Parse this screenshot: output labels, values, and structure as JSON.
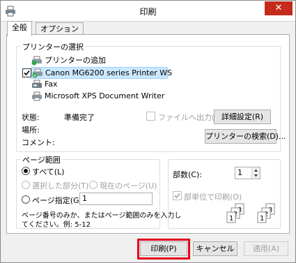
{
  "window": {
    "title": "印刷",
    "close": "✕"
  },
  "tabs": [
    "全般",
    "オプション"
  ],
  "printer_select": {
    "legend": "プリンターの選択",
    "items": [
      {
        "label": "プリンターの追加",
        "icon": "add-printer-icon",
        "checked": false,
        "selected": false
      },
      {
        "label": "Canon MG6200 series Printer WS",
        "icon": "printer-icon",
        "checked": true,
        "selected": true
      },
      {
        "label": "Fax",
        "icon": "fax-icon",
        "checked": false,
        "selected": false
      },
      {
        "label": "Microsoft XPS Document Writer",
        "icon": "printer-icon",
        "checked": false,
        "selected": false
      }
    ],
    "status_label": "状態:",
    "status_value": "準備完了",
    "location_label": "場所:",
    "comment_label": "コメント:",
    "print_to_file": "ファイルへ出力(F)",
    "preferences_button": "詳細設定(R)",
    "find_printer_button": "プリンターの検索(D)..."
  },
  "page_range": {
    "legend": "ページ範囲",
    "all": "すべて(L)",
    "selection": "選択した部分(T)",
    "current_page": "現在のページ(U)",
    "pages": "ページ指定(G):",
    "pages_value": "1",
    "hint_line1": "ページ番号のみか、またはページ範囲のみを入力し",
    "hint_line2": "てください。例: 5-12"
  },
  "copies": {
    "label": "部数(C):",
    "value": "1",
    "collate": "部単位で印刷(O)",
    "collate_checked": true
  },
  "buttons": {
    "print": "印刷(P)",
    "cancel": "キャンセル",
    "apply": "適用(A)"
  },
  "colors": {
    "close": "#c42b1c",
    "selection": "#cce8ff",
    "highlight": "#e3001b"
  }
}
